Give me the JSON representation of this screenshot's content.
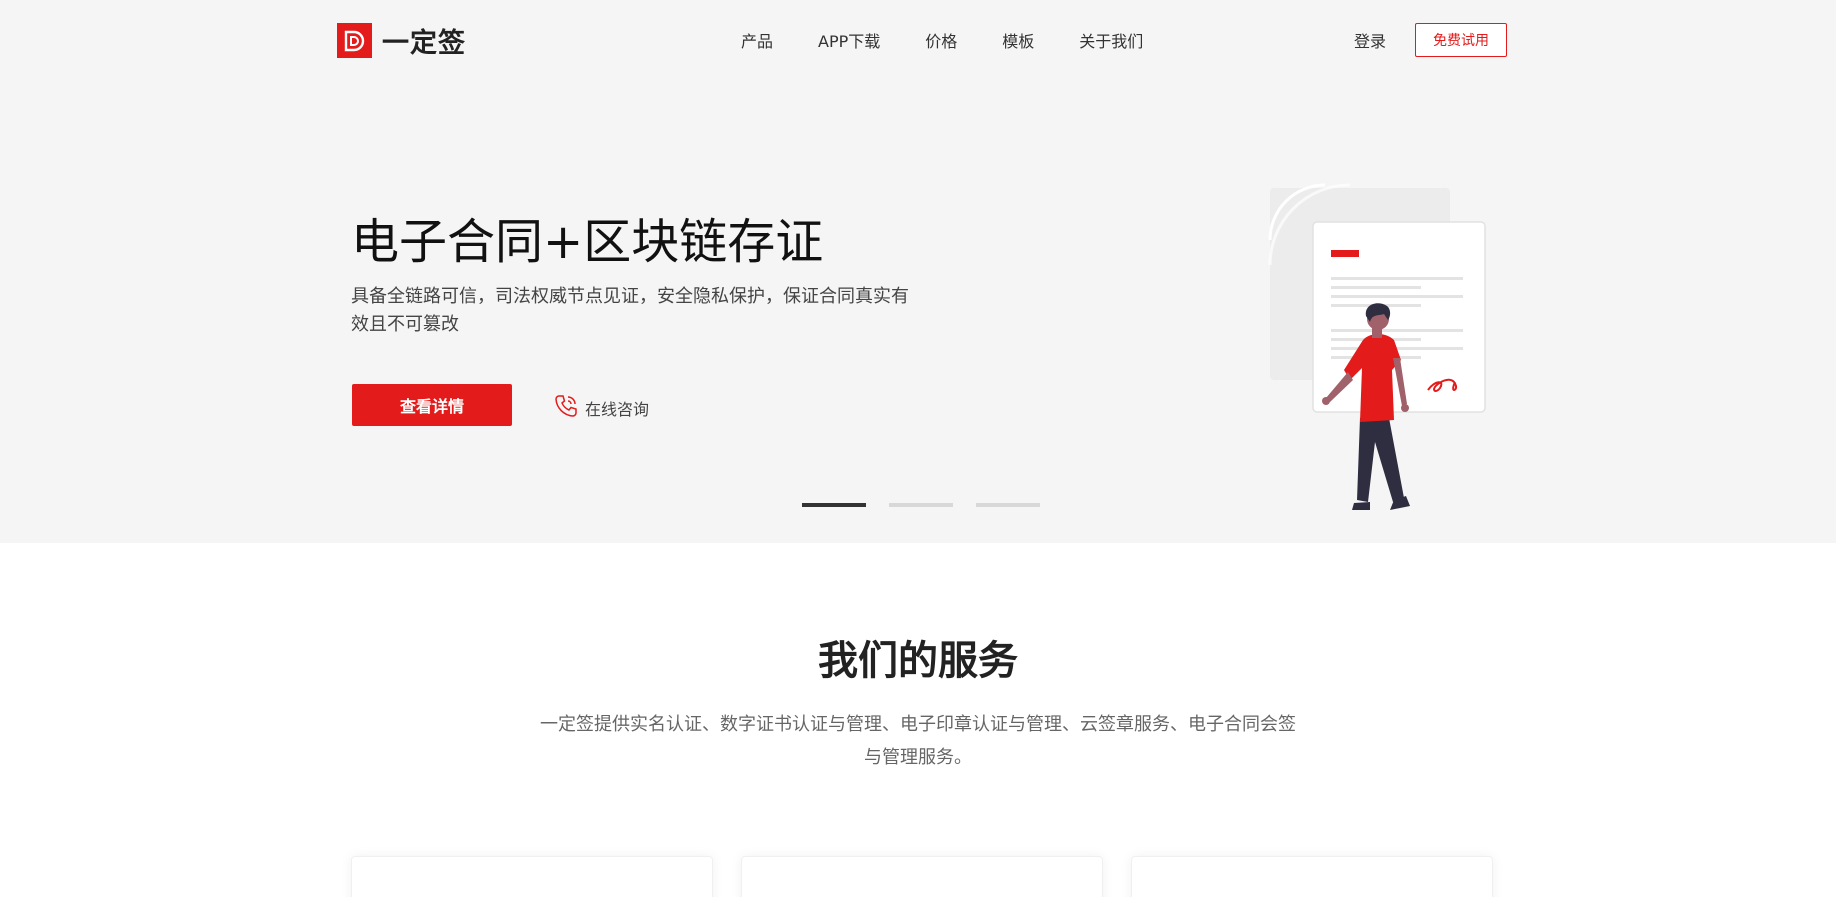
{
  "header": {
    "brand": "一定签",
    "nav": [
      "产品",
      "APP下载",
      "价格",
      "模板",
      "关于我们"
    ],
    "login": "登录",
    "trial": "免费试用"
  },
  "hero": {
    "title": "电子合同+区块链存证",
    "description": "具备全链路可信，司法权威节点见证，安全隐私保护，保证合同真实有效且不可篡改",
    "detail_button": "查看详情",
    "consult": "在线咨询",
    "slides": 3,
    "active_slide": 1
  },
  "services": {
    "title": "我们的服务",
    "description": "一定签提供实名认证、数字证书认证与管理、电子印章认证与管理、云签章服务、电子合同会签与管理服务。"
  },
  "colors": {
    "accent": "#e31b1b",
    "hero_bg": "#f5f5f5"
  }
}
